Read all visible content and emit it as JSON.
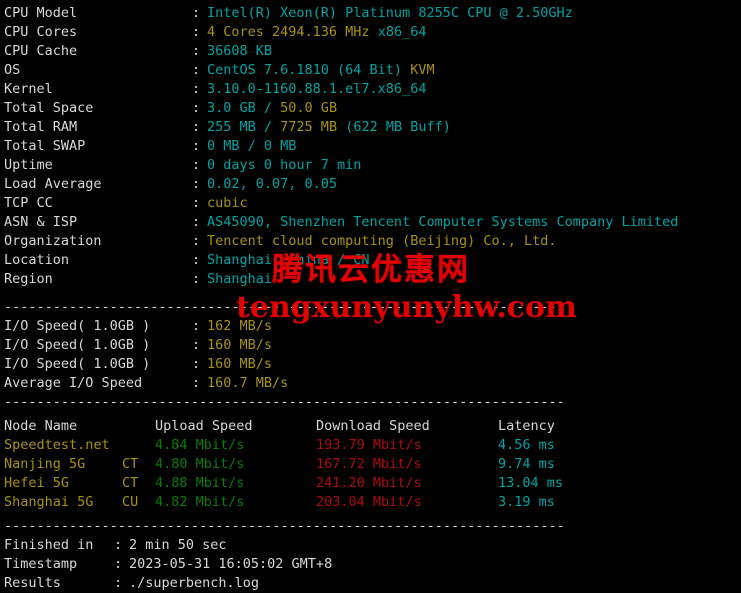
{
  "terminal": {
    "separator": "---------------------------------------------------------------------",
    "system_info": [
      {
        "label": "CPU Model",
        "parts": [
          {
            "t": "Intel(R) Xeon(R) Platinum 8255C CPU @ 2.50GHz",
            "c": "cyan"
          }
        ]
      },
      {
        "label": "CPU Cores",
        "parts": [
          {
            "t": "4 Cores 2494.136 MHz ",
            "c": "yellow"
          },
          {
            "t": "x86_64",
            "c": "cyan"
          }
        ]
      },
      {
        "label": "CPU Cache",
        "parts": [
          {
            "t": "36608 KB",
            "c": "cyan"
          }
        ]
      },
      {
        "label": "OS",
        "parts": [
          {
            "t": "CentOS 7.6.1810 (64 Bit) ",
            "c": "cyan"
          },
          {
            "t": "KVM",
            "c": "yellow"
          }
        ]
      },
      {
        "label": "Kernel",
        "parts": [
          {
            "t": "3.10.0-1160.88.1.el7.x86_64",
            "c": "cyan"
          }
        ]
      },
      {
        "label": "Total Space",
        "parts": [
          {
            "t": "3.0 GB ",
            "c": "cyan"
          },
          {
            "t": "/ ",
            "c": "cyan"
          },
          {
            "t": "50.0 GB",
            "c": "yellow"
          }
        ]
      },
      {
        "label": "Total RAM",
        "parts": [
          {
            "t": "255 MB ",
            "c": "cyan"
          },
          {
            "t": "/ ",
            "c": "cyan"
          },
          {
            "t": "7725 MB ",
            "c": "yellow"
          },
          {
            "t": "(622 MB Buff)",
            "c": "cyan"
          }
        ]
      },
      {
        "label": "Total SWAP",
        "parts": [
          {
            "t": "0 MB / 0 MB",
            "c": "cyan"
          }
        ]
      },
      {
        "label": "Uptime",
        "parts": [
          {
            "t": "0 days 0 hour 7 min",
            "c": "cyan"
          }
        ]
      },
      {
        "label": "Load Average",
        "parts": [
          {
            "t": "0.02, 0.07, 0.05",
            "c": "cyan"
          }
        ]
      },
      {
        "label": "TCP CC",
        "parts": [
          {
            "t": "cubic",
            "c": "yellow"
          }
        ]
      },
      {
        "label": "ASN & ISP",
        "parts": [
          {
            "t": "AS45090, Shenzhen Tencent Computer Systems Company Limited",
            "c": "cyan"
          }
        ]
      },
      {
        "label": "Organization",
        "parts": [
          {
            "t": "Tencent cloud computing (Beijing) Co., Ltd.",
            "c": "yellow"
          }
        ]
      },
      {
        "label": "Location",
        "parts": [
          {
            "t": "Shanghai, China / CN",
            "c": "cyan"
          }
        ]
      },
      {
        "label": "Region",
        "parts": [
          {
            "t": "Shanghai",
            "c": "cyan"
          }
        ]
      }
    ],
    "io_tests": [
      {
        "label": "I/O Speed( 1.0GB )",
        "value": "162 MB/s"
      },
      {
        "label": "I/O Speed( 1.0GB )",
        "value": "160 MB/s"
      },
      {
        "label": "I/O Speed( 1.0GB )",
        "value": "160 MB/s"
      },
      {
        "label": "Average I/O Speed",
        "value": "160.7 MB/s"
      }
    ],
    "network": {
      "headers": {
        "node": "Node Name",
        "upload": "Upload Speed",
        "download": "Download Speed",
        "latency": "Latency"
      },
      "rows": [
        {
          "node": "Speedtest.net",
          "isp": "",
          "upload": "4.84 Mbit/s",
          "download": "193.79 Mbit/s",
          "latency": "4.56 ms"
        },
        {
          "node": "Nanjing 5G",
          "isp": "CT",
          "upload": "4.80 Mbit/s",
          "download": "167.72 Mbit/s",
          "latency": "9.74 ms"
        },
        {
          "node": "Hefei 5G",
          "isp": "CT",
          "upload": "4.88 Mbit/s",
          "download": "241.20 Mbit/s",
          "latency": "13.04 ms"
        },
        {
          "node": "Shanghai 5G",
          "isp": "CU",
          "upload": "4.82 Mbit/s",
          "download": "203.04 Mbit/s",
          "latency": "3.19 ms"
        }
      ]
    },
    "footer": [
      {
        "label": "Finished in",
        "value": "2 min 50 sec"
      },
      {
        "label": "Timestamp",
        "value": "2023-05-31 16:05:02 GMT+8"
      },
      {
        "label": "Results",
        "value": "./superbench.log"
      }
    ]
  },
  "watermark": {
    "chinese": "腾讯云优惠网",
    "url": "tengxunyunyhw.com",
    "color": "#e30000"
  },
  "colors": {
    "background": "#000000",
    "text": "#d8d8d8",
    "cyan": "#00a3a3",
    "yellow": "#a8920f",
    "green": "#0a7a0a",
    "red": "#ab0c0c"
  }
}
